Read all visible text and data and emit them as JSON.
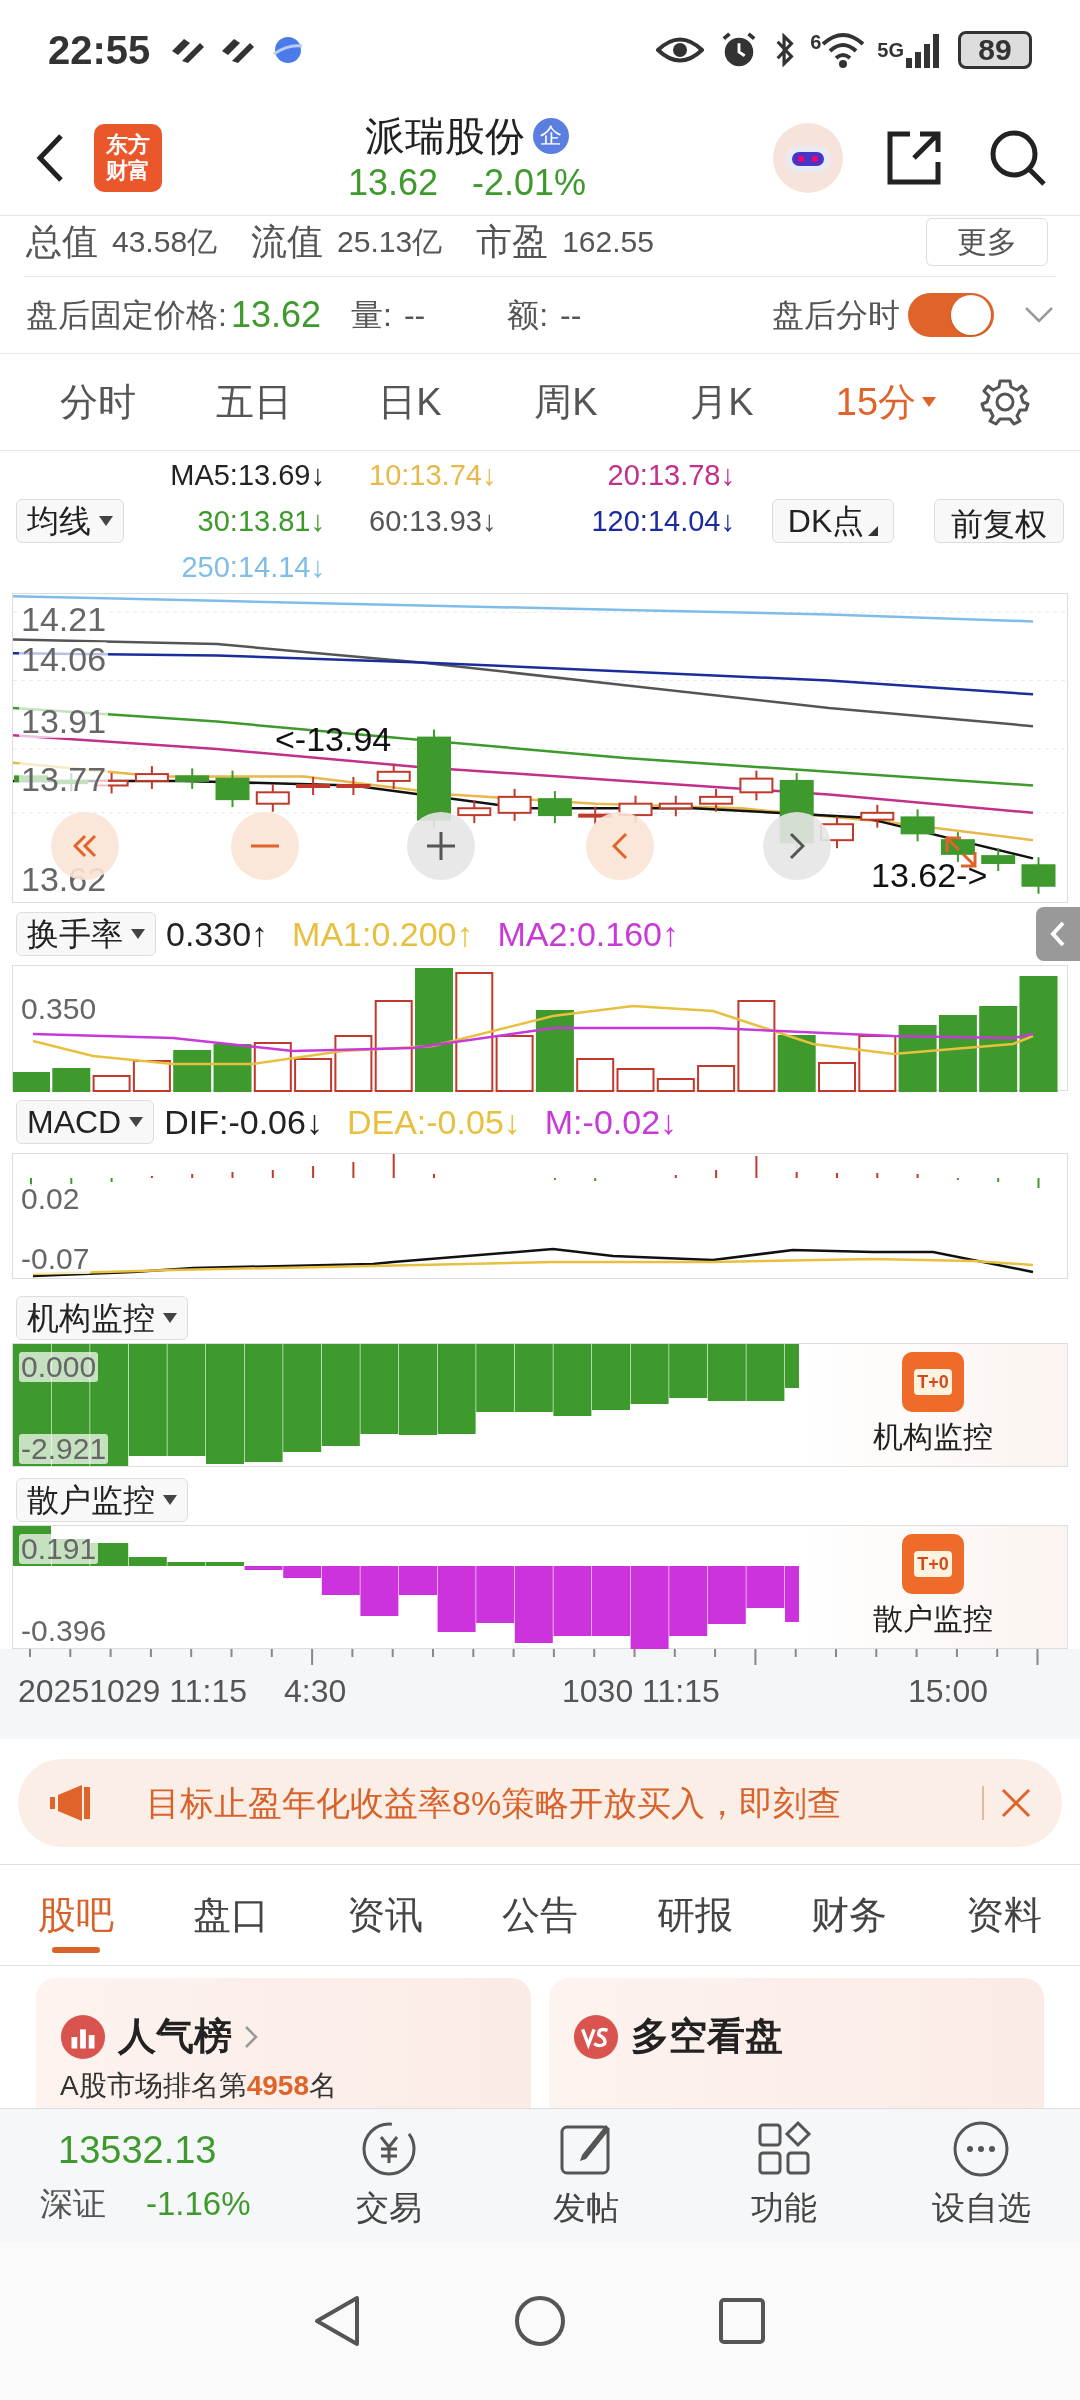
{
  "status_bar": {
    "time": "22:55",
    "wifi_label": "6",
    "network": "5G",
    "battery": "89"
  },
  "header": {
    "logo_lines": [
      "东方",
      "财富"
    ],
    "title": "派瑞股份",
    "badge": "企",
    "price": "13.62",
    "change": "-2.01%"
  },
  "summary_row": {
    "items": [
      "总值",
      "43.58亿",
      "流值",
      "25.13亿",
      "市盈",
      "162.55"
    ],
    "more": "更多"
  },
  "after_hours": {
    "label": "盘后固定价格:",
    "price": "13.62",
    "volume_label": "量:",
    "volume": "--",
    "amount_label": "额:",
    "amount": "--",
    "toggle_label": "盘后分时",
    "toggle_on": true
  },
  "periods": [
    {
      "label": "分时",
      "selected": false
    },
    {
      "label": "五日",
      "selected": false
    },
    {
      "label": "日K",
      "selected": false
    },
    {
      "label": "周K",
      "selected": false
    },
    {
      "label": "月K",
      "selected": false
    },
    {
      "label": "15分",
      "selected": true
    }
  ],
  "ma_panel": {
    "selector": "均线",
    "dk_button": "DK点",
    "adjust_button": "前复权",
    "legend": [
      {
        "text": "MA5:13.69↓",
        "color": "#222222"
      },
      {
        "text": "10:13.74↓",
        "color": "#e8b84a"
      },
      {
        "text": "20:13.78↓",
        "color": "#c2308a"
      },
      {
        "text": "30:13.81↓",
        "color": "#3e9a2c"
      },
      {
        "text": "60:13.93↓",
        "color": "#555555"
      },
      {
        "text": "120:14.04↓",
        "color": "#1c2c9c"
      },
      {
        "text": "250:14.14↓",
        "color": "#7fbde8"
      }
    ]
  },
  "price_chart": {
    "y_labels": [
      "14.21",
      "14.06",
      "13.91",
      "13.77",
      "13.62"
    ],
    "high_marker": "<-13.94",
    "last_marker": "13.62->"
  },
  "turnover": {
    "selector": "换手率",
    "legend": [
      {
        "text": "0.330↑",
        "color": "#222222"
      },
      {
        "text": "MA1:0.200↑",
        "color": "#e8c040"
      },
      {
        "text": "MA2:0.160↑",
        "color": "#c83ad8"
      }
    ],
    "y_labels": [
      "0.350"
    ]
  },
  "macd": {
    "selector": "MACD",
    "legend": [
      {
        "text": "DIF:-0.06↓",
        "color": "#222222"
      },
      {
        "text": "DEA:-0.05↓",
        "color": "#e8c040"
      },
      {
        "text": "M:-0.02↓",
        "color": "#c83ad8"
      }
    ],
    "y_labels": [
      "0.02",
      "-0.07"
    ]
  },
  "institution": {
    "selector": "机构监控",
    "y_labels": [
      "0.000",
      "-2.921"
    ],
    "promo_icon": "T+0",
    "promo_label": "机构监控"
  },
  "retail": {
    "selector": "散户监控",
    "y_labels": [
      "0.191",
      "-0.396"
    ],
    "promo_icon": "T+0",
    "promo_label": "散户监控"
  },
  "time_axis": [
    "20251029 11:15",
    "4:30",
    "1030 11:15",
    "15:00"
  ],
  "banner": {
    "text": "目标止盈年化收益率8%策略开放买入，即刻查"
  },
  "tabs": [
    {
      "label": "股吧",
      "selected": true
    },
    {
      "label": "盘口",
      "selected": false
    },
    {
      "label": "资讯",
      "selected": false
    },
    {
      "label": "公告",
      "selected": false
    },
    {
      "label": "研报",
      "selected": false
    },
    {
      "label": "财务",
      "selected": false
    },
    {
      "label": "资料",
      "selected": false
    }
  ],
  "cards": [
    {
      "title": "人气榜",
      "text": "A股市场排名第**4958**名"
    },
    {
      "title": "多空看盘"
    }
  ],
  "index_bar": {
    "value": "13532.13",
    "name": "深证",
    "change": "-1.16%"
  },
  "actions": [
    "交易",
    "发帖",
    "功能",
    "设自选"
  ]
}
